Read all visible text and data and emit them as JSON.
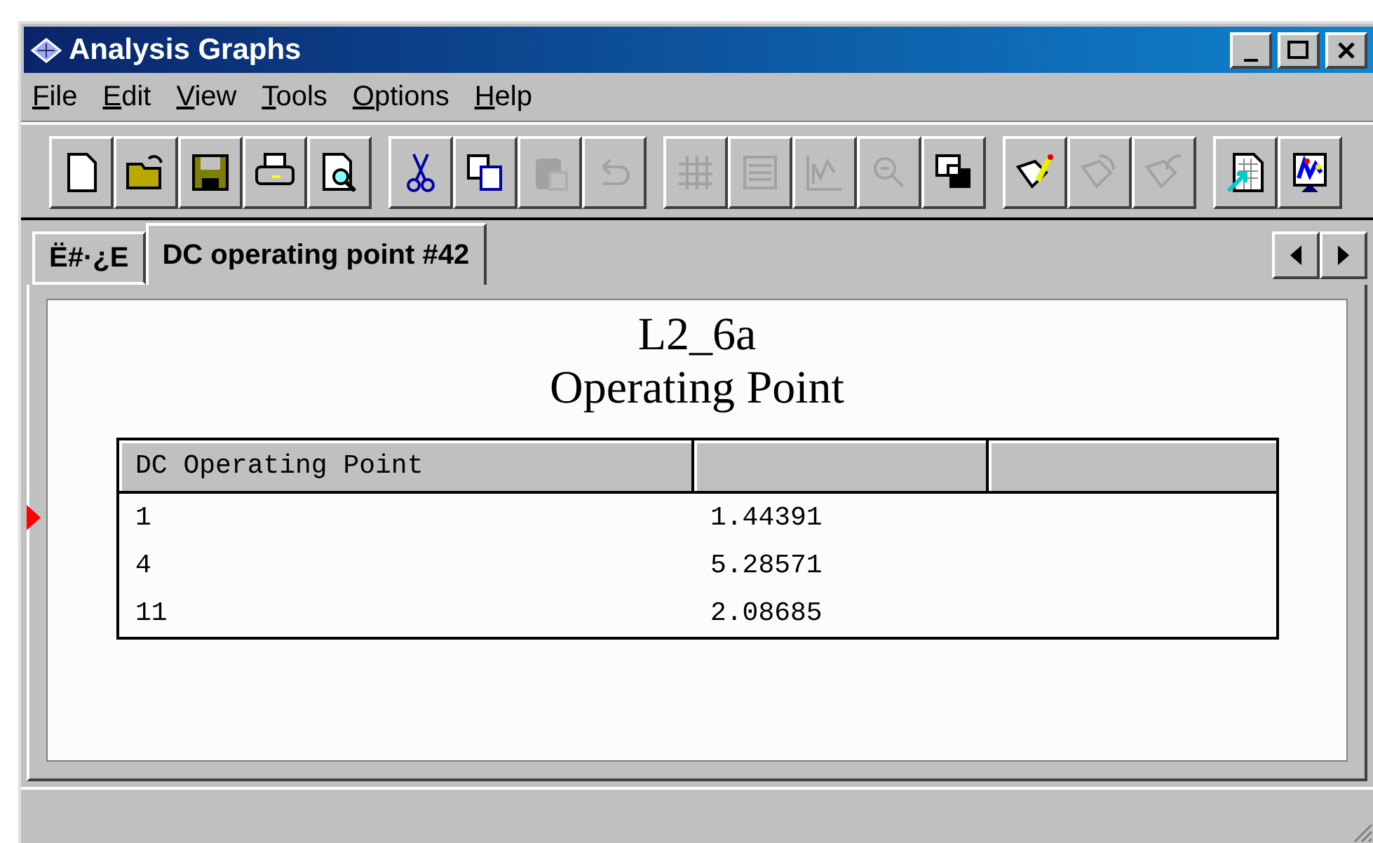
{
  "window": {
    "title": "Analysis Graphs"
  },
  "menu": [
    "File",
    "Edit",
    "View",
    "Tools",
    "Options",
    "Help"
  ],
  "toolbar": [
    [
      {
        "disabled": false
      },
      {
        "disabled": false
      },
      {
        "disabled": false
      },
      {
        "disabled": false
      },
      {
        "disabled": false
      }
    ],
    [
      {
        "disabled": false
      },
      {
        "disabled": false
      },
      {
        "disabled": true
      },
      {
        "disabled": true
      }
    ],
    [
      {
        "disabled": true
      },
      {
        "disabled": true
      },
      {
        "disabled": true
      },
      {
        "disabled": true
      },
      {
        "disabled": false
      }
    ],
    [
      {
        "disabled": false
      },
      {
        "disabled": true
      },
      {
        "disabled": true
      }
    ],
    [
      {
        "disabled": false
      },
      {
        "disabled": false
      }
    ]
  ],
  "tabs": [
    {
      "label": "Ë#·¿E",
      "selected": false
    },
    {
      "label": "DC operating point #42",
      "selected": true
    }
  ],
  "graph": {
    "title": "L2_6a",
    "subtitle": "Operating Point"
  },
  "table": {
    "columns": [
      "DC Operating Point",
      "",
      ""
    ],
    "rows": [
      {
        "cells": [
          "1",
          "1.44391",
          ""
        ],
        "selected": true
      },
      {
        "cells": [
          "4",
          "5.28571",
          ""
        ],
        "selected": false
      },
      {
        "cells": [
          "11",
          "2.08685",
          ""
        ],
        "selected": false
      }
    ]
  }
}
